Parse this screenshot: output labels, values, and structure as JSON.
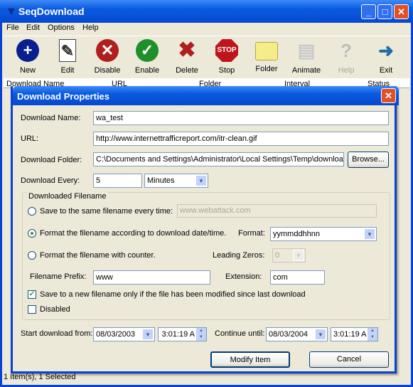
{
  "window": {
    "title": "SeqDownload"
  },
  "menu": [
    "File",
    "Edit",
    "Options",
    "Help"
  ],
  "toolbar": [
    {
      "label": "New",
      "icon": "plus-circle-icon",
      "color": "#0a1f8f"
    },
    {
      "label": "Edit",
      "icon": "edit-document-icon",
      "color": "#ffffff"
    },
    {
      "label": "Disable",
      "icon": "x-circle-icon",
      "color": "#b01e1e"
    },
    {
      "label": "Enable",
      "icon": "check-circle-icon",
      "color": "#1f8f2a"
    },
    {
      "label": "Delete",
      "icon": "delete-x-icon",
      "color": "#b01e1e"
    },
    {
      "label": "Stop",
      "icon": "stop-sign-icon",
      "color": "#c0141b"
    },
    {
      "label": "Folder",
      "icon": "folder-icon",
      "color": "#f5ec8a"
    },
    {
      "label": "Animate",
      "icon": "monitor-icon",
      "color": "#c8c8c8"
    },
    {
      "label": "Help",
      "icon": "help-icon",
      "color": "#bdbdbd",
      "disabled": true
    },
    {
      "label": "Exit",
      "icon": "exit-door-icon",
      "color": "#1e6fa8"
    }
  ],
  "list": {
    "columns": [
      "Download Name",
      "URL",
      "Folder",
      "Interval",
      "Status"
    ]
  },
  "status": "1 Item(s), 1 Selected",
  "dialog": {
    "title": "Download Properties",
    "name_label": "Download Name:",
    "name_value": "wa_test",
    "url_label": "URL:",
    "url_value": "http://www.internettrafficreport.com/itr-clean.gif",
    "folder_label": "Download Folder:",
    "folder_value": "C:\\Documents and Settings\\Administrator\\Local Settings\\Temp\\downloa",
    "browse": "Browse...",
    "every_label": "Download Every:",
    "every_value": "5",
    "every_unit": "Minutes",
    "group_label": "Downloaded Filename",
    "opt_same": "Save to the same filename every time:",
    "opt_same_value": "www.webattack.com",
    "opt_date": "Format the filename according to download date/time.",
    "format_label": "Format:",
    "format_value": "yymmddhhnn",
    "opt_counter": "Format the filename with counter.",
    "zeros_label": "Leading Zeros:",
    "zeros_value": "0",
    "prefix_label": "Filename Prefix:",
    "prefix_value": "www",
    "ext_label": "Extension:",
    "ext_value": "com",
    "modified_label": "Save to a new filename only if the file has been  modified since last download",
    "modified_checked": true,
    "disabled_label": "Disabled",
    "disabled_checked": false,
    "selected_option": "date",
    "start_label": "Start download from:",
    "start_date": "08/03/2003",
    "start_time": "3:01:19 A",
    "until_label": "Continue until:",
    "until_date": "08/03/2004",
    "until_time": "3:01:19 A",
    "modify": "Modify Item",
    "cancel": "Cancel"
  }
}
